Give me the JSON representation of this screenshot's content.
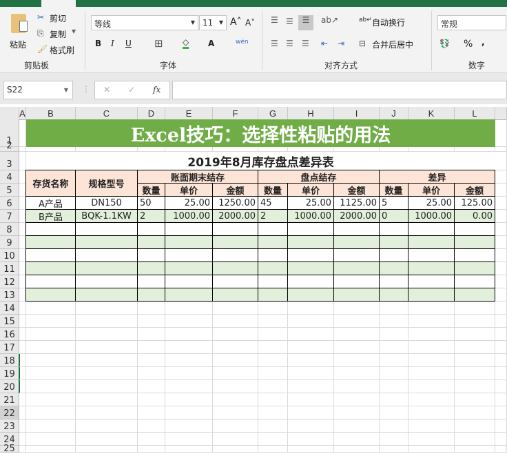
{
  "ribbon": {
    "clipboard": {
      "paste": "粘贴",
      "cut": "剪切",
      "copy": "复制",
      "format_painter": "格式刷",
      "label": "剪贴板"
    },
    "font": {
      "name": "等线",
      "size": "11",
      "bold": "B",
      "italic": "I",
      "underline": "U",
      "phonetic": "wén",
      "label": "字体"
    },
    "alignment": {
      "wrap_text": "自动换行",
      "merge_center": "合并后居中",
      "label": "对齐方式"
    },
    "number": {
      "format": "常规",
      "percent": "%",
      "comma": ",",
      "label": "数字"
    }
  },
  "formula_bar": {
    "name_box": "S22",
    "fx": "fx",
    "value": ""
  },
  "columns": [
    "A",
    "B",
    "C",
    "D",
    "E",
    "F",
    "G",
    "H",
    "I",
    "J",
    "K",
    "L"
  ],
  "rows": [
    "1",
    "2",
    "3",
    "4",
    "5",
    "6",
    "7",
    "8",
    "9",
    "10",
    "11",
    "12",
    "13",
    "14",
    "15",
    "16",
    "17",
    "18",
    "19",
    "20",
    "21",
    "22",
    "23",
    "24",
    "25"
  ],
  "selected_row": "22",
  "colors": {
    "title_fill": "#70ad47",
    "header_fill": "#fce4d6",
    "band_fill": "#e2efda",
    "ribbon_green": "#217346"
  },
  "sheet": {
    "banner": "Excel技巧：选择性粘贴的用法",
    "table_title": "2019年8月库存盘点差异表",
    "headers": {
      "name": "存货名称",
      "spec": "规格型号",
      "book": "账面期末结存",
      "count": "盘点结存",
      "diff": "差异"
    },
    "sub_headers": [
      "数量",
      "单价",
      "金额",
      "数量",
      "单价",
      "金额",
      "数量",
      "单价",
      "金额"
    ],
    "data_rows": [
      [
        "A产品",
        "DN150",
        "50",
        "25.00",
        "1250.00",
        "45",
        "25.00",
        "1125.00",
        "5",
        "25.00",
        "125.00"
      ],
      [
        "B产品",
        "BQK-1.1KW",
        "2",
        "1000.00",
        "2000.00",
        "2",
        "1000.00",
        "2000.00",
        "0",
        "1000.00",
        "0.00"
      ]
    ]
  }
}
